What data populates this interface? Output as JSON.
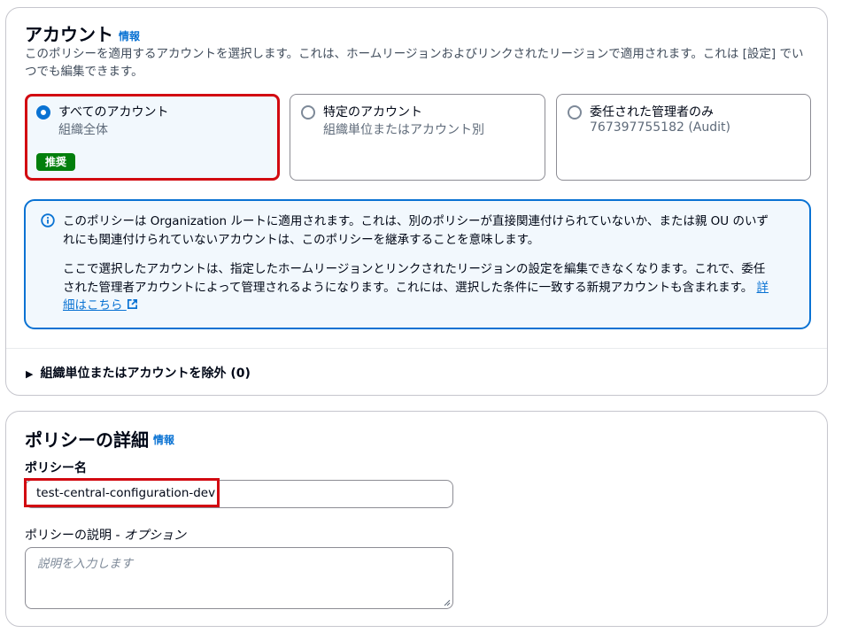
{
  "account_section": {
    "title": "アカウント",
    "info_label": "情報",
    "description": "このポリシーを適用するアカウントを選択します。これは、ホームリージョンおよびリンクされたリージョンで適用されます。これは [設定] でいつでも編集できます。",
    "options": [
      {
        "label": "すべてのアカウント",
        "sublabel": "組織全体",
        "badge": "推奨",
        "selected": true
      },
      {
        "label": "特定のアカウント",
        "sublabel": "組織単位またはアカウント別",
        "selected": false
      },
      {
        "label": "委任された管理者のみ",
        "sublabel": "767397755182 (Audit)",
        "selected": false
      }
    ],
    "alert": {
      "paragraph1": "このポリシーは Organization ルートに適用されます。これは、別のポリシーが直接関連付けられていないか、または親 OU のいずれにも関連付けられていないアカウントは、このポリシーを継承することを意味します。",
      "paragraph2": "ここで選択したアカウントは、指定したホームリージョンとリンクされたリージョンの設定を編集できなくなります。これで、委任された管理者アカウントによって管理されるようになります。これには、選択した条件に一致する新規アカウントも含まれます。",
      "link_text": "詳細はこちら"
    },
    "exclude_expander": "組織単位またはアカウントを除外 (0)"
  },
  "policy_section": {
    "title": "ポリシーの詳細",
    "info_label": "情報",
    "name_label": "ポリシー名",
    "name_value": "test-central-configuration-dev",
    "description_label": "ポリシーの説明 - ",
    "description_optional": "オプション",
    "description_placeholder": "説明を入力します"
  },
  "colors": {
    "accent": "#0972d3",
    "highlight": "#d20a11",
    "badge": "#037f0c"
  }
}
